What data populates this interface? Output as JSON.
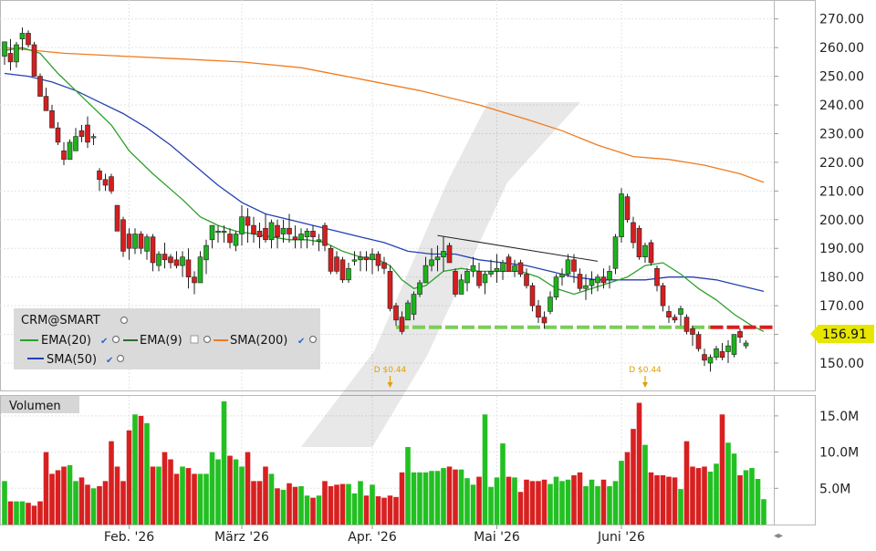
{
  "chart_data": {
    "type": "candlestick",
    "symbol": "CRM@SMART",
    "price_axis": {
      "ylim": [
        143,
        275
      ],
      "ticks": [
        "270.00",
        "260.00",
        "250.00",
        "240.00",
        "230.00",
        "220.00",
        "210.00",
        "200.00",
        "190.00",
        "180.00",
        "170.00",
        "160.00",
        "150.00"
      ],
      "tick_values": [
        270,
        260,
        250,
        240,
        230,
        220,
        210,
        200,
        190,
        180,
        170,
        160,
        150
      ]
    },
    "last_price": {
      "label": "156.91",
      "value": 156.91,
      "color": "#e6e600"
    },
    "x_axis": {
      "month_labels": [
        {
          "label": "Feb. '26",
          "index": 21
        },
        {
          "label": "März '26",
          "index": 40
        },
        {
          "label": "Apr. '26",
          "index": 62
        },
        {
          "label": "Mai '26",
          "index": 83
        },
        {
          "label": "Juni '26",
          "index": 104
        }
      ]
    },
    "legend": {
      "title": "CRM@SMART",
      "items": [
        {
          "label": "EMA(20)",
          "color": "#2ca02c"
        },
        {
          "label": "EMA(9)",
          "color": "#2e6b2e"
        },
        {
          "label": "SMA(200)",
          "color": "#f07b1f"
        },
        {
          "label": "SMA(50)",
          "color": "#2541b2"
        }
      ]
    },
    "dividends": [
      {
        "label": "D $0.44",
        "index": 65
      },
      {
        "label": "D $0.44",
        "index": 108
      }
    ],
    "support_level": 162.5,
    "trendline": [
      {
        "index": 73,
        "value": 194.5
      },
      {
        "index": 100,
        "value": 185.5
      }
    ],
    "candles": [
      {
        "o": 257,
        "h": 262,
        "l": 254,
        "c": 262
      },
      {
        "o": 258,
        "h": 263,
        "l": 252,
        "c": 255
      },
      {
        "o": 255,
        "h": 262,
        "l": 253,
        "c": 261
      },
      {
        "o": 263,
        "h": 267,
        "l": 259,
        "c": 265
      },
      {
        "o": 265,
        "h": 266,
        "l": 260,
        "c": 261
      },
      {
        "o": 261,
        "h": 262,
        "l": 250,
        "c": 250
      },
      {
        "o": 250,
        "h": 251,
        "l": 243,
        "c": 243
      },
      {
        "o": 243,
        "h": 246,
        "l": 238,
        "c": 238
      },
      {
        "o": 238,
        "h": 240,
        "l": 232,
        "c": 232
      },
      {
        "o": 232,
        "h": 234,
        "l": 226,
        "c": 227
      },
      {
        "o": 224,
        "h": 227,
        "l": 219,
        "c": 221
      },
      {
        "o": 221,
        "h": 228,
        "l": 221,
        "c": 227
      },
      {
        "o": 224,
        "h": 232,
        "l": 224,
        "c": 229
      },
      {
        "o": 231,
        "h": 233,
        "l": 227,
        "c": 229
      },
      {
        "o": 233,
        "h": 236,
        "l": 225,
        "c": 227
      },
      {
        "o": 229,
        "h": 230,
        "l": 226,
        "c": 229
      },
      {
        "o": 217,
        "h": 218,
        "l": 210,
        "c": 214
      },
      {
        "o": 214,
        "h": 216,
        "l": 210,
        "c": 212
      },
      {
        "o": 215,
        "h": 216,
        "l": 209,
        "c": 210
      },
      {
        "o": 205,
        "h": 205,
        "l": 196,
        "c": 196
      },
      {
        "o": 200,
        "h": 201,
        "l": 187,
        "c": 189
      },
      {
        "o": 195,
        "h": 197,
        "l": 186,
        "c": 190
      },
      {
        "o": 190,
        "h": 197,
        "l": 188,
        "c": 195
      },
      {
        "o": 195,
        "h": 196,
        "l": 188,
        "c": 190
      },
      {
        "o": 189,
        "h": 195,
        "l": 186,
        "c": 194
      },
      {
        "o": 194,
        "h": 195,
        "l": 182,
        "c": 185
      },
      {
        "o": 184,
        "h": 189,
        "l": 182,
        "c": 188
      },
      {
        "o": 188,
        "h": 192,
        "l": 183,
        "c": 186
      },
      {
        "o": 187,
        "h": 188,
        "l": 183,
        "c": 185
      },
      {
        "o": 186,
        "h": 189,
        "l": 183,
        "c": 184
      },
      {
        "o": 184,
        "h": 189,
        "l": 180,
        "c": 187
      },
      {
        "o": 186,
        "h": 190,
        "l": 176,
        "c": 180
      },
      {
        "o": 180,
        "h": 182,
        "l": 174,
        "c": 178
      },
      {
        "o": 178,
        "h": 189,
        "l": 178,
        "c": 187
      },
      {
        "o": 186,
        "h": 193,
        "l": 181,
        "c": 191
      },
      {
        "o": 193,
        "h": 198,
        "l": 190,
        "c": 198
      },
      {
        "o": 196,
        "h": 198,
        "l": 192,
        "c": 196
      },
      {
        "o": 196,
        "h": 198,
        "l": 192,
        "c": 196
      },
      {
        "o": 195,
        "h": 197,
        "l": 190,
        "c": 192
      },
      {
        "o": 191,
        "h": 196,
        "l": 189,
        "c": 195
      },
      {
        "o": 195,
        "h": 205,
        "l": 191,
        "c": 201
      },
      {
        "o": 201,
        "h": 204,
        "l": 192,
        "c": 198
      },
      {
        "o": 198,
        "h": 201,
        "l": 192,
        "c": 195
      },
      {
        "o": 196,
        "h": 199,
        "l": 190,
        "c": 194
      },
      {
        "o": 197,
        "h": 202,
        "l": 192,
        "c": 193
      },
      {
        "o": 193,
        "h": 200,
        "l": 190,
        "c": 199
      },
      {
        "o": 198,
        "h": 200,
        "l": 190,
        "c": 194
      },
      {
        "o": 195,
        "h": 200,
        "l": 192,
        "c": 197
      },
      {
        "o": 197,
        "h": 202,
        "l": 192,
        "c": 195
      },
      {
        "o": 194,
        "h": 198,
        "l": 190,
        "c": 193
      },
      {
        "o": 193,
        "h": 197,
        "l": 190,
        "c": 195
      },
      {
        "o": 194,
        "h": 197,
        "l": 190,
        "c": 196
      },
      {
        "o": 196,
        "h": 198,
        "l": 191,
        "c": 194
      },
      {
        "o": 193,
        "h": 195,
        "l": 189,
        "c": 193
      },
      {
        "o": 198,
        "h": 199,
        "l": 189,
        "c": 191
      },
      {
        "o": 190,
        "h": 191,
        "l": 181,
        "c": 182
      },
      {
        "o": 187,
        "h": 189,
        "l": 181,
        "c": 182
      },
      {
        "o": 186,
        "h": 187,
        "l": 178,
        "c": 179
      },
      {
        "o": 179,
        "h": 185,
        "l": 178,
        "c": 183
      },
      {
        "o": 186,
        "h": 189,
        "l": 184,
        "c": 186
      },
      {
        "o": 186,
        "h": 189,
        "l": 182,
        "c": 187
      },
      {
        "o": 187,
        "h": 189,
        "l": 182,
        "c": 186
      },
      {
        "o": 186,
        "h": 190,
        "l": 181,
        "c": 188
      },
      {
        "o": 188,
        "h": 189,
        "l": 182,
        "c": 184
      },
      {
        "o": 185,
        "h": 187,
        "l": 181,
        "c": 183
      },
      {
        "o": 182,
        "h": 184,
        "l": 168,
        "c": 169
      },
      {
        "o": 170,
        "h": 171,
        "l": 163,
        "c": 165
      },
      {
        "o": 166,
        "h": 168,
        "l": 160,
        "c": 161
      },
      {
        "o": 165,
        "h": 172,
        "l": 165,
        "c": 171
      },
      {
        "o": 167,
        "h": 175,
        "l": 165,
        "c": 174
      },
      {
        "o": 174,
        "h": 179,
        "l": 173,
        "c": 178
      },
      {
        "o": 178,
        "h": 187,
        "l": 178,
        "c": 184
      },
      {
        "o": 184,
        "h": 190,
        "l": 182,
        "c": 186
      },
      {
        "o": 186,
        "h": 191,
        "l": 182,
        "c": 187
      },
      {
        "o": 187,
        "h": 194,
        "l": 182,
        "c": 189
      },
      {
        "o": 191,
        "h": 192,
        "l": 185,
        "c": 185
      },
      {
        "o": 182,
        "h": 183,
        "l": 173,
        "c": 174
      },
      {
        "o": 174,
        "h": 181,
        "l": 174,
        "c": 179
      },
      {
        "o": 178,
        "h": 183,
        "l": 175,
        "c": 182
      },
      {
        "o": 182,
        "h": 187,
        "l": 180,
        "c": 184
      },
      {
        "o": 182,
        "h": 185,
        "l": 176,
        "c": 177
      },
      {
        "o": 178,
        "h": 182,
        "l": 174,
        "c": 181
      },
      {
        "o": 181,
        "h": 186,
        "l": 180,
        "c": 182
      },
      {
        "o": 182,
        "h": 188,
        "l": 178,
        "c": 183
      },
      {
        "o": 182,
        "h": 186,
        "l": 179,
        "c": 185
      },
      {
        "o": 187,
        "h": 188,
        "l": 182,
        "c": 182
      },
      {
        "o": 182,
        "h": 186,
        "l": 180,
        "c": 184
      },
      {
        "o": 185,
        "h": 186,
        "l": 180,
        "c": 181
      },
      {
        "o": 181,
        "h": 183,
        "l": 176,
        "c": 177
      },
      {
        "o": 177,
        "h": 178,
        "l": 168,
        "c": 170
      },
      {
        "o": 170,
        "h": 172,
        "l": 164,
        "c": 166
      },
      {
        "o": 166,
        "h": 168,
        "l": 162,
        "c": 164
      },
      {
        "o": 168,
        "h": 175,
        "l": 167,
        "c": 173
      },
      {
        "o": 173,
        "h": 181,
        "l": 172,
        "c": 180
      },
      {
        "o": 180,
        "h": 183,
        "l": 177,
        "c": 181
      },
      {
        "o": 181,
        "h": 188,
        "l": 180,
        "c": 186
      },
      {
        "o": 186,
        "h": 188,
        "l": 178,
        "c": 182
      },
      {
        "o": 181,
        "h": 183,
        "l": 175,
        "c": 176
      },
      {
        "o": 176,
        "h": 181,
        "l": 172,
        "c": 177
      },
      {
        "o": 177,
        "h": 182,
        "l": 174,
        "c": 179
      },
      {
        "o": 178,
        "h": 181,
        "l": 175,
        "c": 180
      },
      {
        "o": 180,
        "h": 183,
        "l": 176,
        "c": 178
      },
      {
        "o": 179,
        "h": 184,
        "l": 176,
        "c": 182
      },
      {
        "o": 183,
        "h": 195,
        "l": 181,
        "c": 194
      },
      {
        "o": 194,
        "h": 211,
        "l": 192,
        "c": 209
      },
      {
        "o": 208,
        "h": 209,
        "l": 199,
        "c": 200
      },
      {
        "o": 199,
        "h": 201,
        "l": 190,
        "c": 192
      },
      {
        "o": 197,
        "h": 198,
        "l": 186,
        "c": 187
      },
      {
        "o": 187,
        "h": 192,
        "l": 185,
        "c": 191
      },
      {
        "o": 192,
        "h": 193,
        "l": 184,
        "c": 185
      },
      {
        "o": 183,
        "h": 184,
        "l": 175,
        "c": 177
      },
      {
        "o": 177,
        "h": 178,
        "l": 168,
        "c": 170
      },
      {
        "o": 168,
        "h": 170,
        "l": 164,
        "c": 166
      },
      {
        "o": 166,
        "h": 167,
        "l": 164,
        "c": 165
      },
      {
        "o": 167,
        "h": 170,
        "l": 163,
        "c": 169
      },
      {
        "o": 166,
        "h": 167,
        "l": 160,
        "c": 161
      },
      {
        "o": 162,
        "h": 163,
        "l": 156,
        "c": 160
      },
      {
        "o": 160,
        "h": 161,
        "l": 154,
        "c": 155
      },
      {
        "o": 153,
        "h": 155,
        "l": 149,
        "c": 151
      },
      {
        "o": 150,
        "h": 153,
        "l": 147,
        "c": 152
      },
      {
        "o": 152,
        "h": 156,
        "l": 151,
        "c": 155
      },
      {
        "o": 154,
        "h": 157,
        "l": 151,
        "c": 152
      },
      {
        "o": 154,
        "h": 158,
        "l": 150,
        "c": 156
      },
      {
        "o": 153,
        "h": 160,
        "l": 152,
        "c": 160
      },
      {
        "o": 161,
        "h": 162,
        "l": 157,
        "c": 159
      },
      {
        "o": 156,
        "h": 158,
        "l": 155,
        "c": 157
      }
    ],
    "ema20": [
      [
        0,
        259
      ],
      [
        3,
        260
      ],
      [
        6,
        258
      ],
      [
        9,
        251
      ],
      [
        12,
        245
      ],
      [
        15,
        239
      ],
      [
        18,
        233
      ],
      [
        21,
        224
      ],
      [
        25,
        216
      ],
      [
        30,
        207
      ],
      [
        33,
        201
      ],
      [
        36,
        198
      ],
      [
        39,
        196
      ],
      [
        42,
        195
      ],
      [
        45,
        194
      ],
      [
        48,
        193
      ],
      [
        51,
        193
      ],
      [
        54,
        192
      ],
      [
        57,
        189
      ],
      [
        60,
        187
      ],
      [
        63,
        186
      ],
      [
        65,
        184
      ],
      [
        67,
        179
      ],
      [
        69,
        176
      ],
      [
        71,
        177
      ],
      [
        74,
        182
      ],
      [
        77,
        183
      ],
      [
        80,
        182
      ],
      [
        84,
        182
      ],
      [
        87,
        182
      ],
      [
        90,
        180
      ],
      [
        93,
        176
      ],
      [
        96,
        174
      ],
      [
        99,
        176
      ],
      [
        102,
        178
      ],
      [
        105,
        180
      ],
      [
        108,
        184
      ],
      [
        111,
        185
      ],
      [
        114,
        181
      ],
      [
        117,
        176
      ],
      [
        120,
        172
      ],
      [
        123,
        167
      ],
      [
        126,
        163
      ],
      [
        128,
        161
      ]
    ],
    "sma50": [
      [
        0,
        251
      ],
      [
        4,
        250
      ],
      [
        8,
        248
      ],
      [
        12,
        245
      ],
      [
        16,
        241
      ],
      [
        20,
        237
      ],
      [
        24,
        232
      ],
      [
        28,
        226
      ],
      [
        32,
        219
      ],
      [
        36,
        212
      ],
      [
        40,
        206
      ],
      [
        44,
        202
      ],
      [
        48,
        200
      ],
      [
        52,
        198
      ],
      [
        56,
        196
      ],
      [
        60,
        194
      ],
      [
        64,
        192
      ],
      [
        68,
        189
      ],
      [
        72,
        188
      ],
      [
        76,
        188
      ],
      [
        80,
        186
      ],
      [
        84,
        185
      ],
      [
        88,
        184
      ],
      [
        92,
        182
      ],
      [
        96,
        180
      ],
      [
        100,
        179
      ],
      [
        104,
        179
      ],
      [
        108,
        179
      ],
      [
        112,
        180
      ],
      [
        116,
        180
      ],
      [
        120,
        179
      ],
      [
        124,
        177
      ],
      [
        128,
        175
      ]
    ],
    "sma200": [
      [
        0,
        260
      ],
      [
        10,
        258
      ],
      [
        20,
        257
      ],
      [
        30,
        256
      ],
      [
        40,
        255
      ],
      [
        50,
        253
      ],
      [
        60,
        249
      ],
      [
        70,
        245
      ],
      [
        80,
        240
      ],
      [
        88,
        235
      ],
      [
        94,
        231
      ],
      [
        100,
        226
      ],
      [
        106,
        222
      ],
      [
        112,
        221
      ],
      [
        118,
        219
      ],
      [
        124,
        216
      ],
      [
        128,
        213
      ]
    ],
    "volume": {
      "ticks": [
        "15.0M",
        "10.0M",
        "5.0M"
      ],
      "tick_values": [
        15,
        10,
        5
      ],
      "ylim": [
        0,
        17
      ],
      "panel_title": "Volumen",
      "values": [
        6,
        3.2,
        3.2,
        3.2,
        3,
        2.6,
        3.2,
        10,
        7,
        7.5,
        8,
        8.2,
        6,
        6.5,
        5.5,
        5,
        5.3,
        6,
        11.5,
        8,
        6,
        13,
        15.2,
        15,
        14,
        8,
        8,
        10,
        9,
        7,
        8,
        7.8,
        7,
        7,
        7,
        10,
        9,
        17,
        9.5,
        9,
        8,
        10,
        6,
        6,
        8,
        7,
        5,
        4.8,
        5.7,
        5.2,
        5.3,
        4,
        3.7,
        4,
        6,
        5.3,
        5.5,
        5.6,
        5.6,
        4.3,
        6,
        4,
        5.5,
        3.9,
        3.7,
        4,
        3.8,
        7.2,
        10.7,
        7.2,
        7.2,
        7.2,
        7.4,
        7.4,
        7.8,
        8,
        7.6,
        7.6,
        6.4,
        5.5,
        6.6,
        15.2,
        5.2,
        6.5,
        11.2,
        6.6,
        6.5,
        4.5,
        6.2,
        6,
        6,
        6.2,
        5.6,
        6.6,
        6,
        6.2,
        6.8,
        7.2,
        5.3,
        6.2,
        5.3,
        6.2,
        5.3,
        6,
        8.8,
        10,
        13.2,
        16.8,
        11,
        7.2,
        6.8,
        6.8,
        6.6,
        6.5,
        4.9,
        11.5,
        8,
        7.8,
        8,
        7.3,
        8.4,
        15.2,
        11.3,
        9.8,
        6.8,
        7.5,
        7.8,
        6.3,
        3.5
      ]
    }
  }
}
